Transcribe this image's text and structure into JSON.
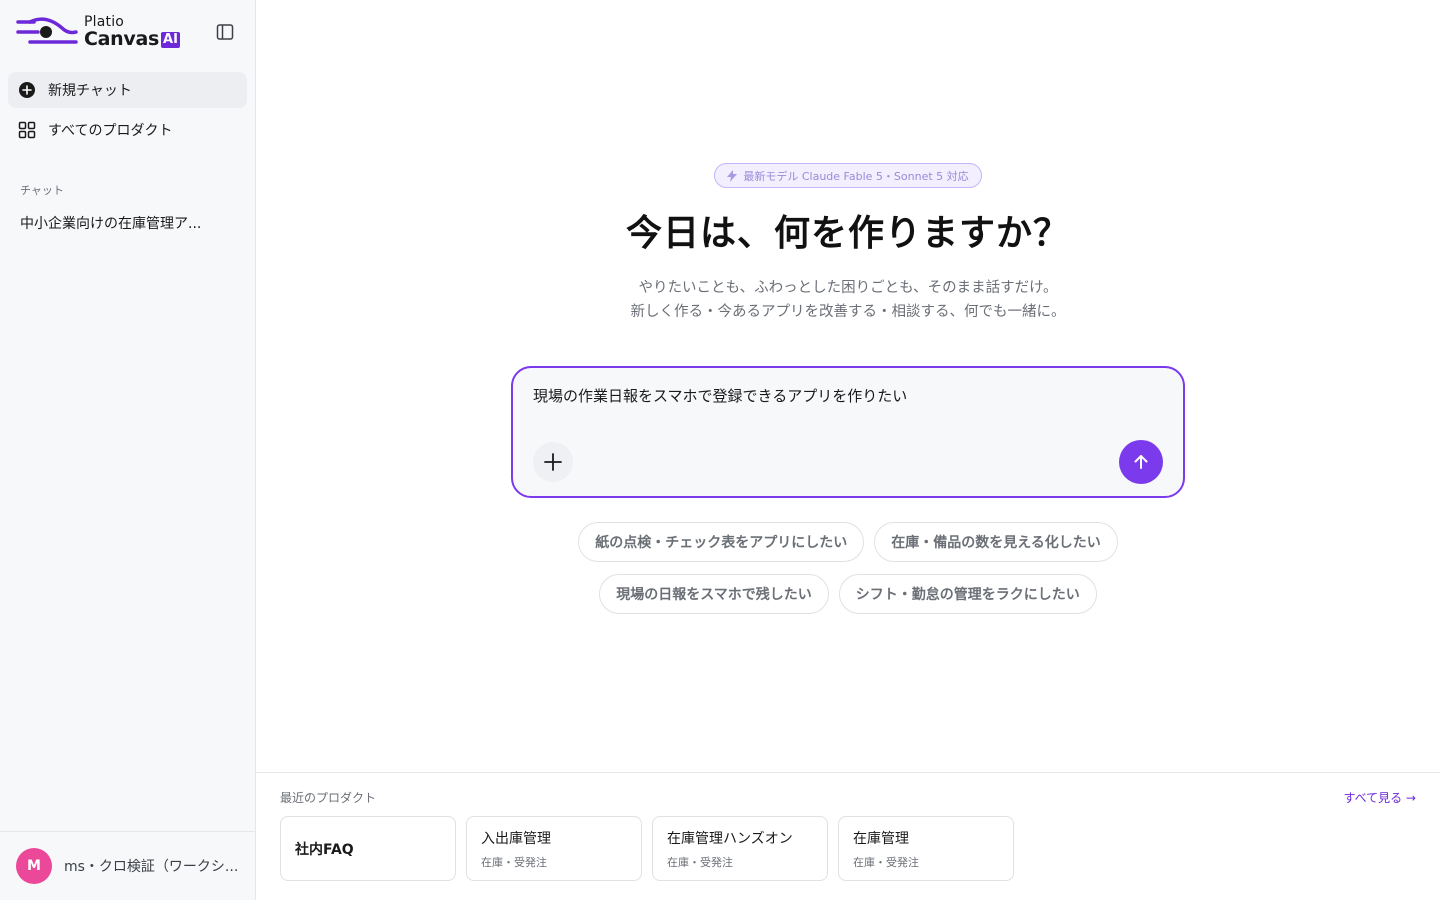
{
  "brand": {
    "logo_top": "Platio",
    "logo_bottom": "Canvas",
    "logo_badge": "AI",
    "accent": "#7c3aed"
  },
  "sidebar": {
    "toggle_icon": "sidebar-toggle-icon",
    "nav": [
      {
        "label": "新規チャット",
        "icon": "plus-circle-icon",
        "active": true
      },
      {
        "label": "すべてのプロダクト",
        "icon": "grid-icon",
        "active": false
      }
    ],
    "section_label": "チャット",
    "chats": [
      {
        "label": "中小企業向けの在庫管理ア..."
      }
    ],
    "user": {
      "initial": "M",
      "name": "ms・クロ検証（ワークシ...",
      "avatar_color": "#ec4899"
    }
  },
  "main": {
    "badge": "最新モデル Claude Fable 5・Sonnet 5 対応",
    "headline": "今日は、何を作りますか？",
    "sub_line1": "やりたいことも、ふわっとした困りごとも、そのまま話すだけ。",
    "sub_line2": "新しく作る・今あるアプリを改善する・相談する、何でも一緒に。",
    "prompt_value": "現場の作業日報をスマホで登録できるアプリを作りたい",
    "suggestions_row1": [
      "紙の点検・チェック表をアプリにしたい",
      "在庫・備品の数を見える化したい"
    ],
    "suggestions_row2": [
      "現場の日報をスマホで残したい",
      "シフト・勤怠の管理をラクにしたい"
    ]
  },
  "recent": {
    "title": "最近のプロダクト",
    "see_all": "すべて見る →",
    "cards": [
      {
        "title": "社内FAQ",
        "sub": ""
      },
      {
        "title": "入出庫管理",
        "sub": "在庫・受発注"
      },
      {
        "title": "在庫管理ハンズオン",
        "sub": "在庫・受発注"
      },
      {
        "title": "在庫管理",
        "sub": "在庫・受発注"
      }
    ]
  }
}
